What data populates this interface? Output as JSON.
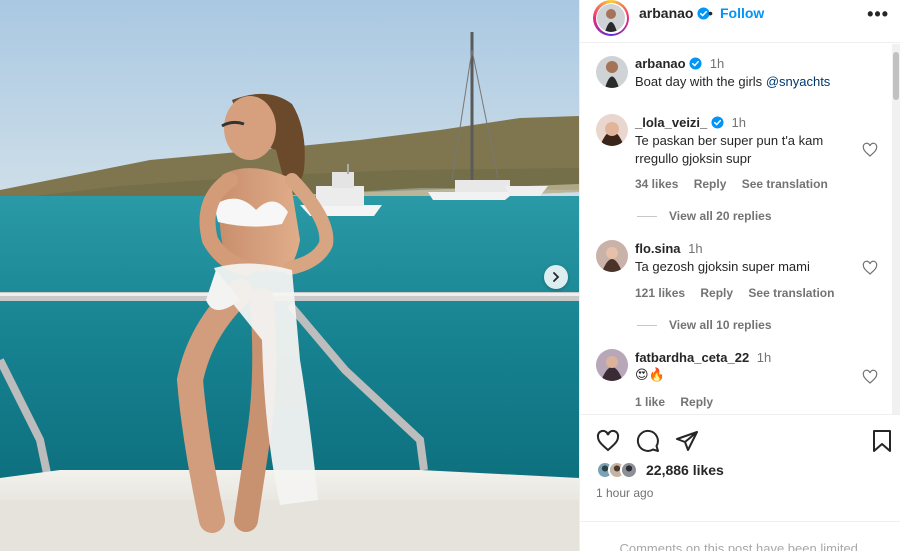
{
  "header": {
    "username": "arbanao",
    "separator": "•",
    "follow_label": "Follow",
    "more_label": "•••"
  },
  "media": {
    "next_icon": "chevron-right-icon"
  },
  "caption": {
    "username": "arbanao",
    "time": "1h",
    "text": "Boat day with the girls",
    "mention": "@snyachts"
  },
  "comments": [
    {
      "username": "_lola_veizi_",
      "verified": true,
      "time": "1h",
      "text_line1": "Te paskan ber super pun t'a kam",
      "text_line2": "rregullo gjoksin supr",
      "likes": "34 likes",
      "reply": "Reply",
      "translate": "See translation",
      "view_replies": "View all 20 replies"
    },
    {
      "username": "flo.sina",
      "verified": false,
      "time": "1h",
      "text_line1": "Ta gezosh gjoksin super mami",
      "likes": "121 likes",
      "reply": "Reply",
      "translate": "See translation",
      "view_replies": "View all 10 replies"
    },
    {
      "username": "fatbardha_ceta_22",
      "verified": false,
      "time": "1h",
      "text_line1": "😍🔥",
      "likes": "1 like",
      "reply": "Reply"
    }
  ],
  "actions": {
    "like_icon": "heart-icon",
    "comment_icon": "comment-icon",
    "share_icon": "send-icon",
    "save_icon": "bookmark-icon",
    "likes": "22,886 likes",
    "time_ago": "1 hour ago"
  },
  "footer": {
    "limited_text": "Comments on this post have been limited."
  },
  "colors": {
    "accent": "#0095f6",
    "verified": "#0095f6",
    "sea": "#1f8a9a",
    "sky": "#b9d3e6"
  }
}
